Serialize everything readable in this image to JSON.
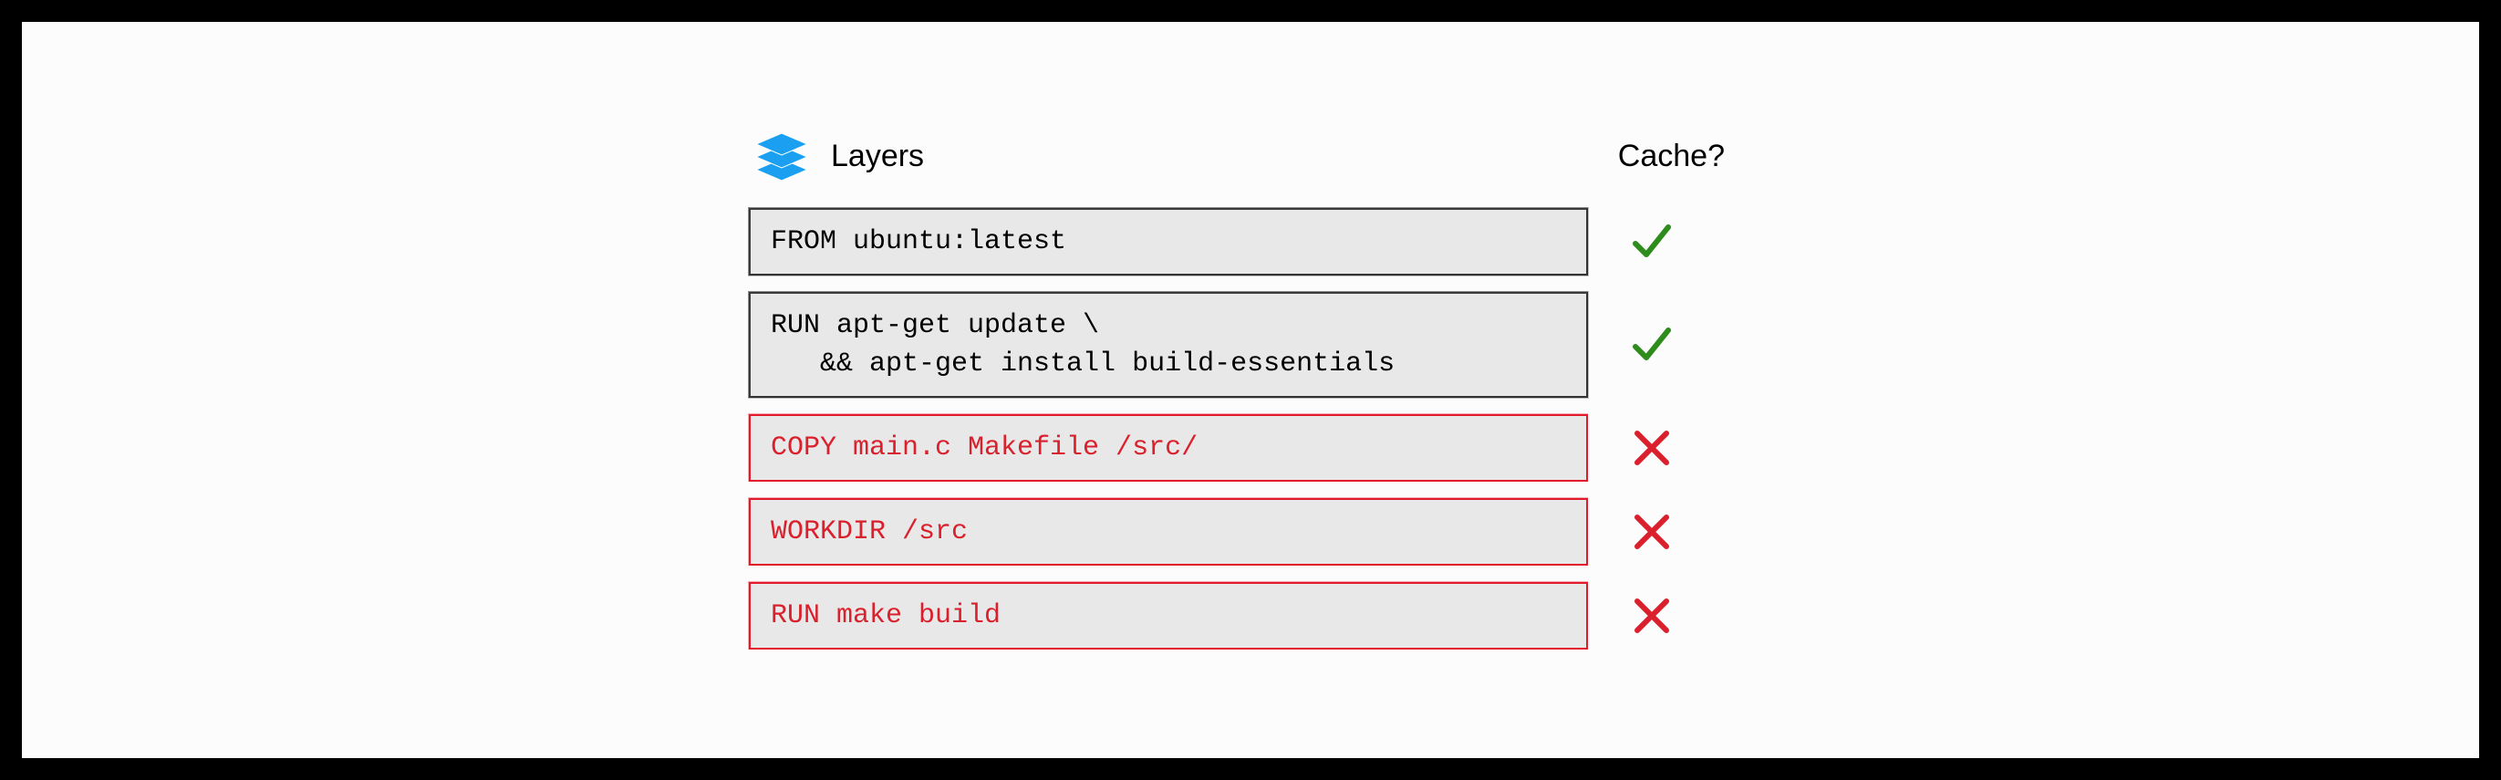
{
  "header": {
    "layers_label": "Layers",
    "cache_label": "Cache?"
  },
  "colors": {
    "accent_blue": "#1b9ff1",
    "cached_check": "#2e8c1d",
    "invalid_cross": "#d9202c",
    "box_bg": "#e8e8e8",
    "border_dark": "#3a3a3a"
  },
  "layers": [
    {
      "code": "FROM ubuntu:latest",
      "cached": true
    },
    {
      "code": "RUN apt-get update \\\n   && apt-get install build-essentials",
      "cached": true
    },
    {
      "code": "COPY main.c Makefile /src/",
      "cached": false
    },
    {
      "code": "WORKDIR /src",
      "cached": false
    },
    {
      "code": "RUN make build",
      "cached": false
    }
  ]
}
